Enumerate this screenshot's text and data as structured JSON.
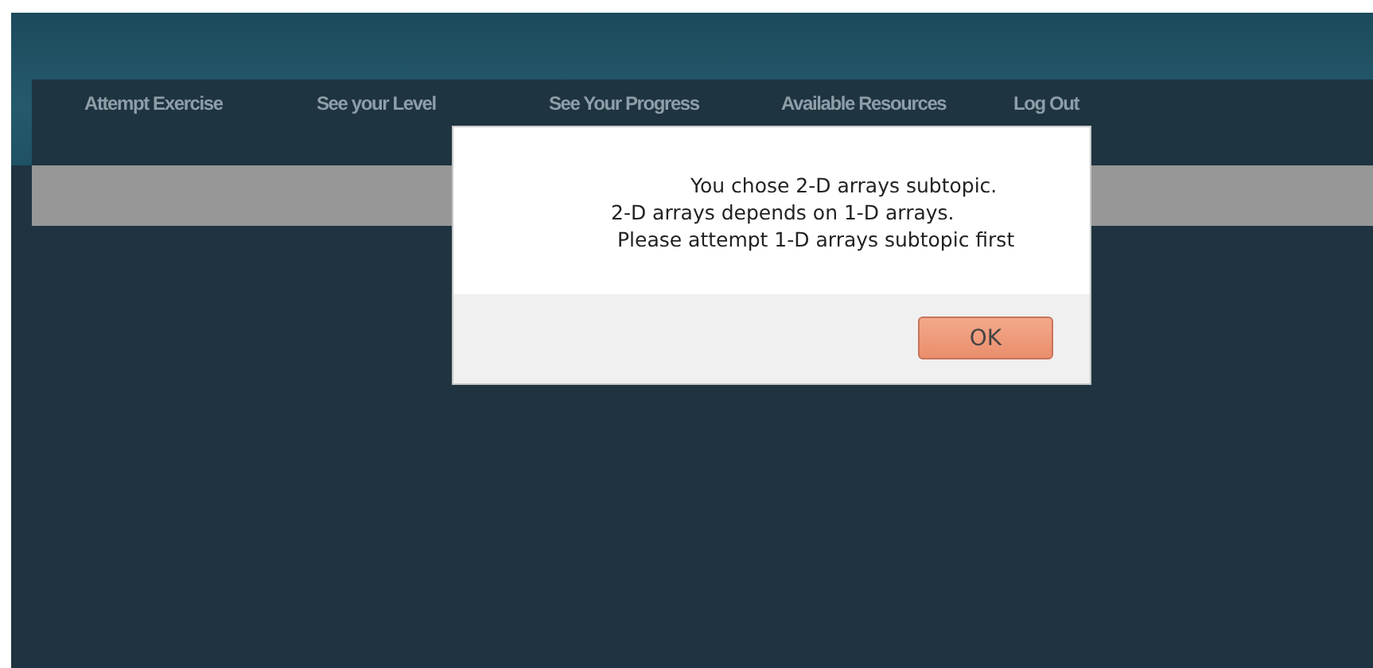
{
  "nav": {
    "items": [
      {
        "label": "Attempt Exercise"
      },
      {
        "label": "See your Level"
      },
      {
        "label": "See Your Progress"
      },
      {
        "label": "Available Resources"
      },
      {
        "label": "Log Out"
      }
    ]
  },
  "dialog": {
    "message_lines": [
      "You chose 2-D arrays subtopic.",
      "2-D arrays depends on 1-D arrays.",
      "Please attempt 1-D arrays subtopic first"
    ],
    "buttons": [
      "OK"
    ]
  }
}
